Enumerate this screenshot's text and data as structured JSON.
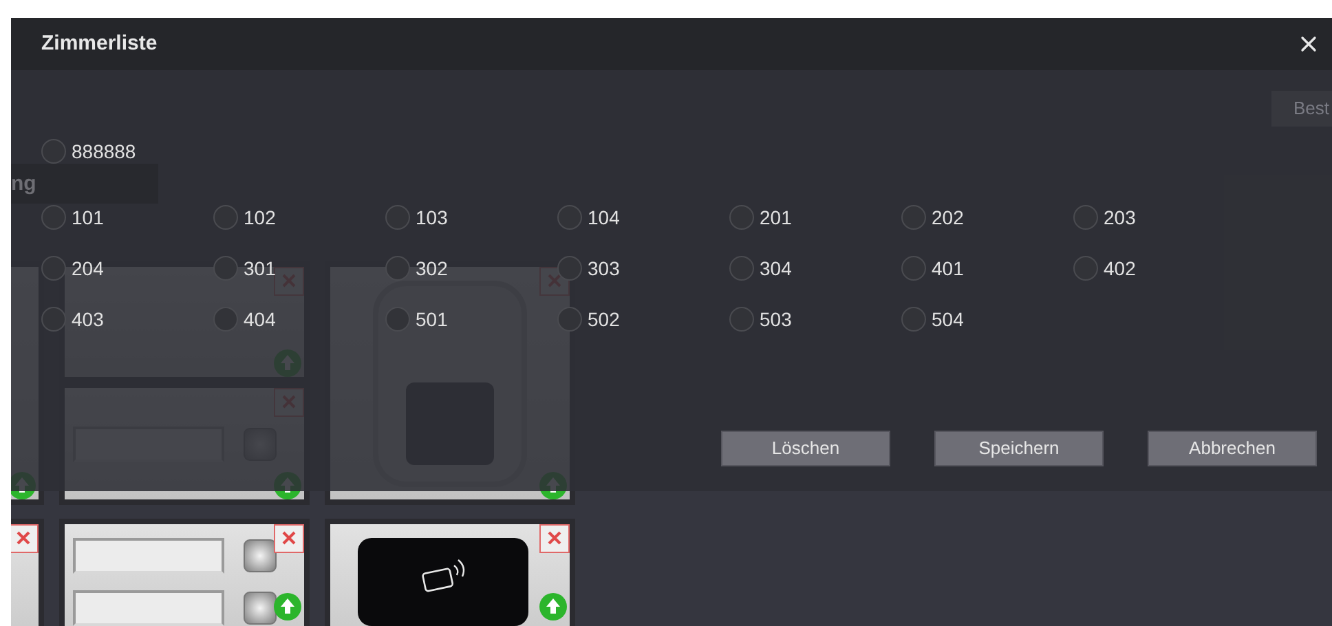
{
  "background": {
    "tab": "ng",
    "button": "Best"
  },
  "dialog": {
    "title": "Zimmerliste",
    "special_rooms": [
      {
        "label": "888888",
        "selected": false
      }
    ],
    "rooms": [
      {
        "label": "101",
        "selected": false
      },
      {
        "label": "102",
        "selected": false
      },
      {
        "label": "103",
        "selected": false
      },
      {
        "label": "104",
        "selected": false
      },
      {
        "label": "201",
        "selected": false
      },
      {
        "label": "202",
        "selected": false
      },
      {
        "label": "203",
        "selected": false
      },
      {
        "label": "204",
        "selected": false
      },
      {
        "label": "301",
        "selected": false
      },
      {
        "label": "302",
        "selected": false
      },
      {
        "label": "303",
        "selected": false
      },
      {
        "label": "304",
        "selected": false
      },
      {
        "label": "401",
        "selected": false
      },
      {
        "label": "402",
        "selected": false
      },
      {
        "label": "403",
        "selected": false
      },
      {
        "label": "404",
        "selected": false
      },
      {
        "label": "501",
        "selected": false
      },
      {
        "label": "502",
        "selected": false
      },
      {
        "label": "503",
        "selected": false
      },
      {
        "label": "504",
        "selected": false
      }
    ],
    "buttons": [
      "Löschen",
      "Speichern",
      "Abbrechen"
    ]
  }
}
